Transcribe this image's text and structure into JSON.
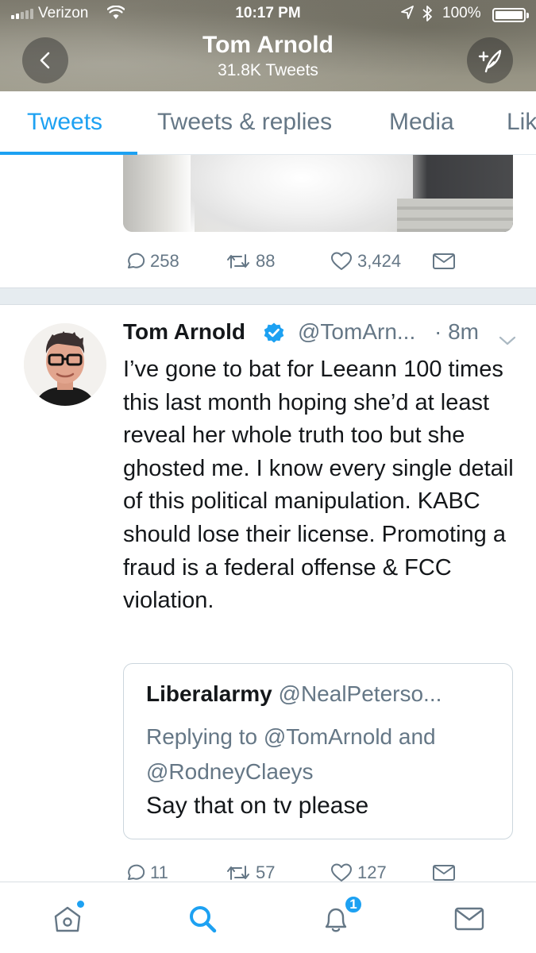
{
  "status_bar": {
    "carrier": "Verizon",
    "time": "10:17 PM",
    "battery": "100%",
    "icons": [
      "signal-icon",
      "wifi-icon",
      "location-icon",
      "bluetooth-icon",
      "battery-icon"
    ]
  },
  "header": {
    "name": "Tom Arnold",
    "tweet_count": "31.8K Tweets",
    "back_icon": "chevron-left-icon",
    "compose_icon": "compose-tweet-icon"
  },
  "tabs": [
    {
      "label": "Tweets",
      "active": true
    },
    {
      "label": "Tweets & replies",
      "active": false
    },
    {
      "label": "Media",
      "active": false
    },
    {
      "label": "Lik",
      "active": false
    }
  ],
  "previous_tweet": {
    "replies": "258",
    "retweets": "88",
    "likes": "3,424"
  },
  "tweet": {
    "author": "Tom Arnold",
    "verified": true,
    "handle": "@TomArn...",
    "time": "· 8m",
    "text": "I’ve gone to bat for Leeann 100 times this last month hoping she’d at least reveal her whole truth too but she ghosted me. I know every single detail of this political manipulation. KABC should lose their license. Promoting a fraud is a federal offense & FCC violation.",
    "quote": {
      "name": "Liberalarmy",
      "handle": "@NealPeterso...",
      "replying_to": "Replying to @TomArnold and @RodneyClaeys",
      "text": "Say that on tv please"
    },
    "replies": "11",
    "retweets": "57",
    "likes": "127"
  },
  "bottom_nav": {
    "items": [
      "home-icon",
      "search-icon",
      "notifications-icon",
      "messages-icon"
    ],
    "notification_count": "1"
  },
  "colors": {
    "accent": "#1da1f2",
    "text": "#14171a",
    "secondary": "#657786",
    "border": "#e1e8ed"
  }
}
